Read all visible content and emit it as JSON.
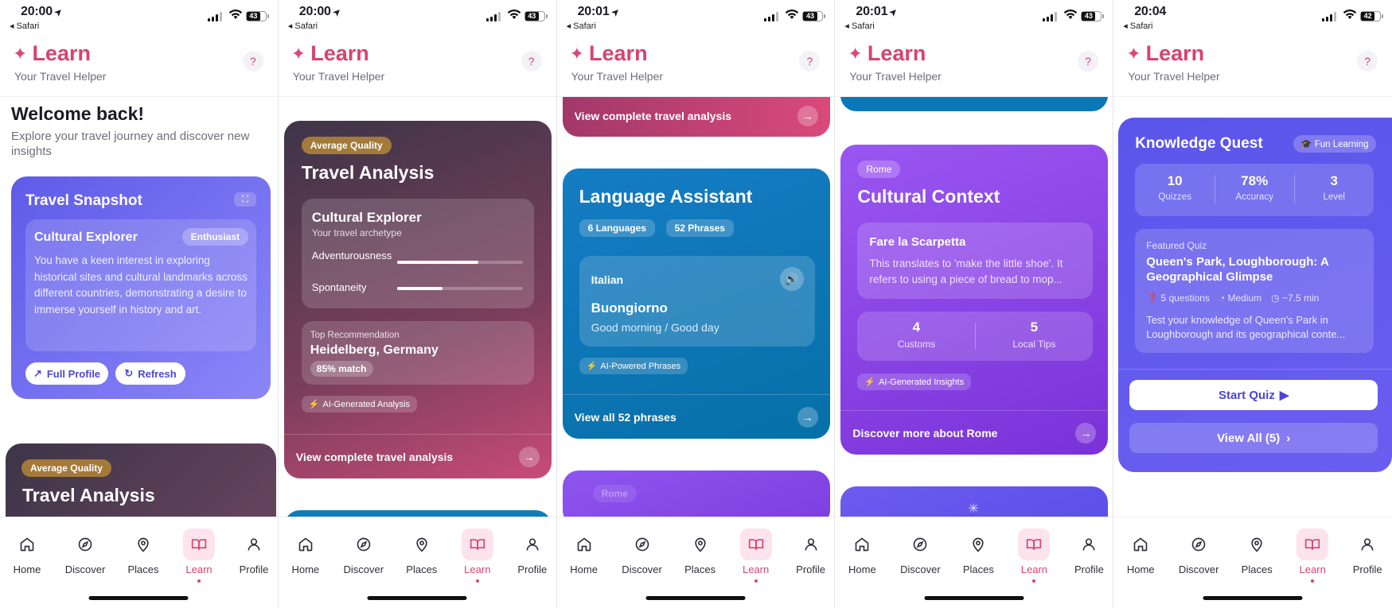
{
  "common": {
    "carrier_back": "◂ Safari",
    "app_title": "Learn",
    "app_subtitle": "Your Travel Helper",
    "help": "?",
    "nav": [
      "Home",
      "Discover",
      "Places",
      "Learn",
      "Profile"
    ],
    "colors": {
      "brand": "#d9426f",
      "snapshot": "#6a63f0",
      "analysis": "#5b3f52",
      "language": "#0e7db8",
      "culture": "#8a3ee6",
      "quest": "#5f56ec"
    }
  },
  "screens": [
    {
      "time": "20:00",
      "battery": "43"
    },
    {
      "time": "20:00",
      "battery": "43"
    },
    {
      "time": "20:01",
      "battery": "43"
    },
    {
      "time": "20:01",
      "battery": "43"
    },
    {
      "time": "20:04",
      "battery": "42"
    }
  ],
  "s1": {
    "welcome": "Welcome back!",
    "intro": "Explore your travel journey and discover new insights",
    "snapshot_title": "Travel Snapshot",
    "archetype": "Cultural Explorer",
    "badge": "Enthusiast",
    "description": "You have a keen interest in exploring historical sites and cultural landmarks across different countries, demonstrating a desire to immerse yourself in history and art.",
    "full_profile": "Full Profile",
    "refresh": "Refresh",
    "quality": "Average Quality",
    "analysis_title": "Travel Analysis"
  },
  "s2": {
    "quality": "Average Quality",
    "title": "Travel Analysis",
    "archetype": "Cultural Explorer",
    "archetype_sub": "Your travel archetype",
    "traits": [
      {
        "label": "Adventurousness",
        "value": 0.65
      },
      {
        "label": "Spontaneity",
        "value": 0.36
      }
    ],
    "rec_label": "Top Recommendation",
    "rec_place": "Heidelberg, Germany",
    "rec_match": "85% match",
    "ai_tag": "AI-Generated Analysis",
    "link": "View complete travel analysis"
  },
  "s3": {
    "prev_link": "View complete travel analysis",
    "title": "Language Assistant",
    "languages": "6 Languages",
    "phrases": "52 Phrases",
    "language": "Italian",
    "phrase": "Buongiorno",
    "translation": "Good morning / Good day",
    "ai_tag": "AI-Powered Phrases",
    "link": "View all 52 phrases",
    "next_pill": "Rome"
  },
  "s4": {
    "city": "Rome",
    "title": "Cultural Context",
    "phrase_title": "Fare la Scarpetta",
    "phrase_desc": "This translates to 'make the little shoe'. It refers to using a piece of bread to mop...",
    "customs_num": "4",
    "customs_label": "Customs",
    "tips_num": "5",
    "tips_label": "Local Tips",
    "ai_tag": "AI-Generated Insights",
    "link": "Discover more about Rome"
  },
  "s5": {
    "title": "Knowledge Quest",
    "badge": "Fun Learning",
    "stats": [
      {
        "num": "10",
        "label": "Quizzes"
      },
      {
        "num": "78%",
        "label": "Accuracy"
      },
      {
        "num": "3",
        "label": "Level"
      }
    ],
    "featured_label": "Featured Quiz",
    "quiz_title": "Queen's Park, Loughborough: A Geographical Glimpse",
    "questions": "5 questions",
    "difficulty": "Medium",
    "duration": "~7.5 min",
    "quiz_desc": "Test your knowledge of Queen's Park in Loughborough and its geographical conte...",
    "start": "Start Quiz",
    "view_all": "View All (5)"
  }
}
